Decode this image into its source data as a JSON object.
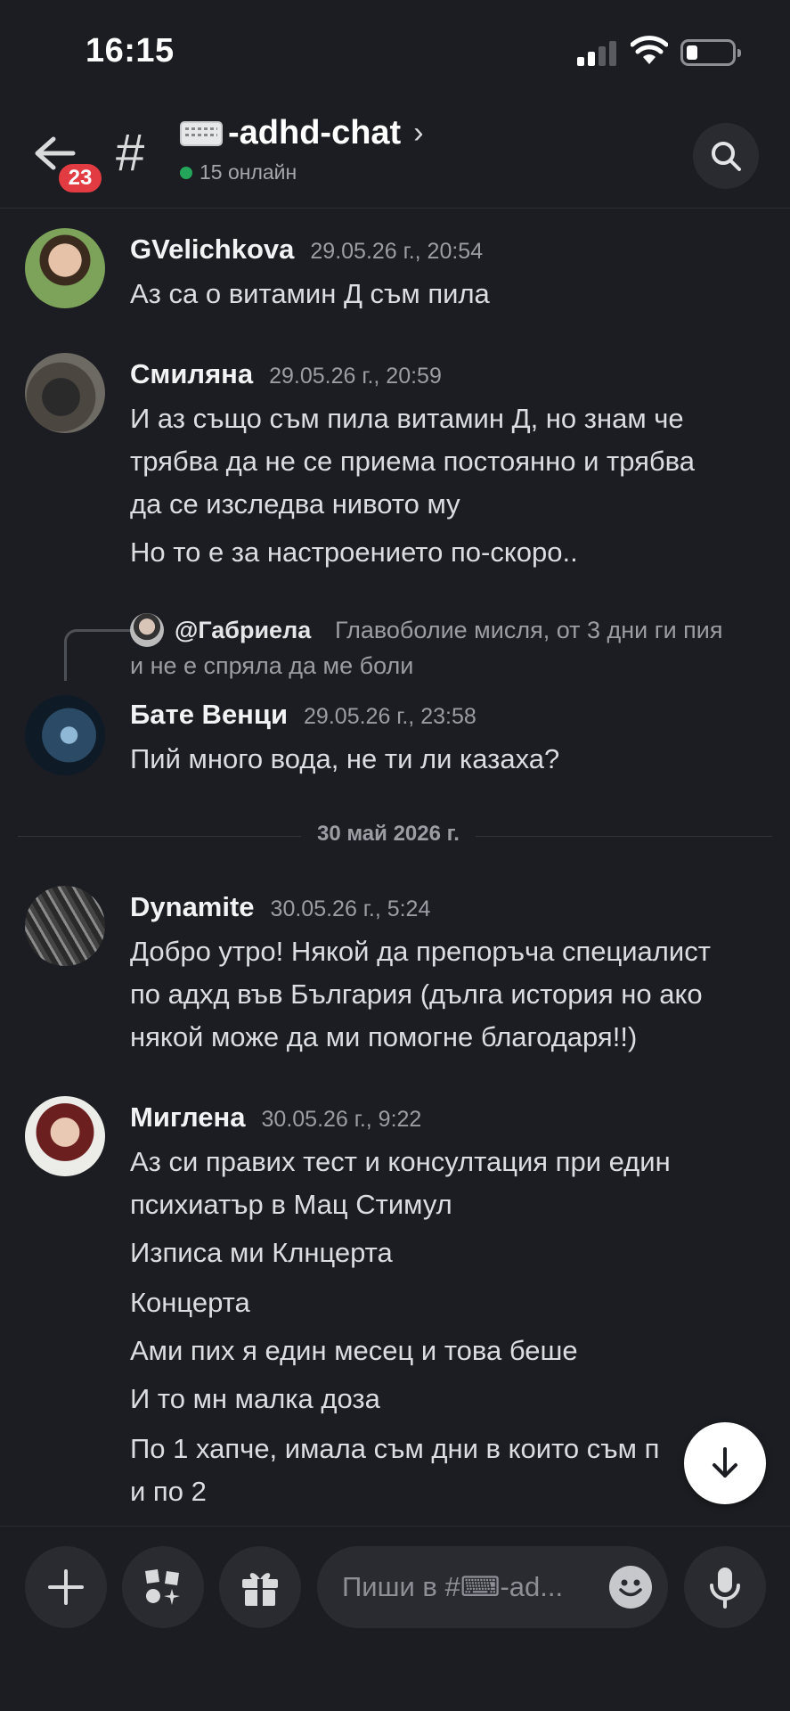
{
  "status_bar": {
    "time": "16:15"
  },
  "header": {
    "unread_count": "23",
    "channel_name": "-adhd-chat",
    "online": "15 онлайн"
  },
  "messages": [
    {
      "author": "GVelichkova",
      "time": "29.05.26 г., 20:54",
      "lines": [
        "Аз са о витамин Д съм пила"
      ]
    },
    {
      "author": "Смиляна",
      "time": "29.05.26 г., 20:59",
      "lines": [
        "И аз също съм пила витамин Д, но знам че",
        "трябва да не се приема постоянно и трябва",
        "да се изследва нивото му",
        "Но то е за настроението по-скоро.."
      ]
    },
    {
      "reply": {
        "author": "@Габриела",
        "text_line1": "Главоболие мисля, от 3 дни ги пия",
        "text_line2": "и не е спряла да ме боли"
      },
      "author": "Бате Венци",
      "time": "29.05.26 г., 23:58",
      "lines": [
        "Пий много вода, не ти ли казаха?"
      ]
    },
    {
      "author": "Dynamite",
      "time": "30.05.26 г., 5:24",
      "lines": [
        "Добро утро! Някой да препоръча специалист",
        "по адхд във България (дълга история но ако",
        "някой може да ми помогне благодаря!!)"
      ]
    },
    {
      "author": "Миглена",
      "time": "30.05.26 г., 9:22",
      "lines": [
        "Аз си правих тест и консултация при един",
        "психиатър в Мац Стимул",
        "Изписа ми Клнцерта",
        "Концерта",
        "Ами пих я един месец и това беше",
        "И то мн малка доза",
        "По 1 хапче, имала съм дни в които съм п",
        "и по 2"
      ]
    }
  ],
  "date_divider": "30 май 2026 г.",
  "composer": {
    "placeholder": "Пиши в #⌨-ad..."
  },
  "icons": {
    "back": "arrow-left-icon",
    "search": "search-icon",
    "plus": "plus-icon",
    "apps": "apps-icon",
    "gift": "gift-icon",
    "emoji": "emoji-icon",
    "mic": "microphone-icon",
    "scroll_down": "arrow-down-icon"
  },
  "colors": {
    "background": "#1c1d22",
    "online": "#23a55a",
    "badge": "#e23b41"
  }
}
